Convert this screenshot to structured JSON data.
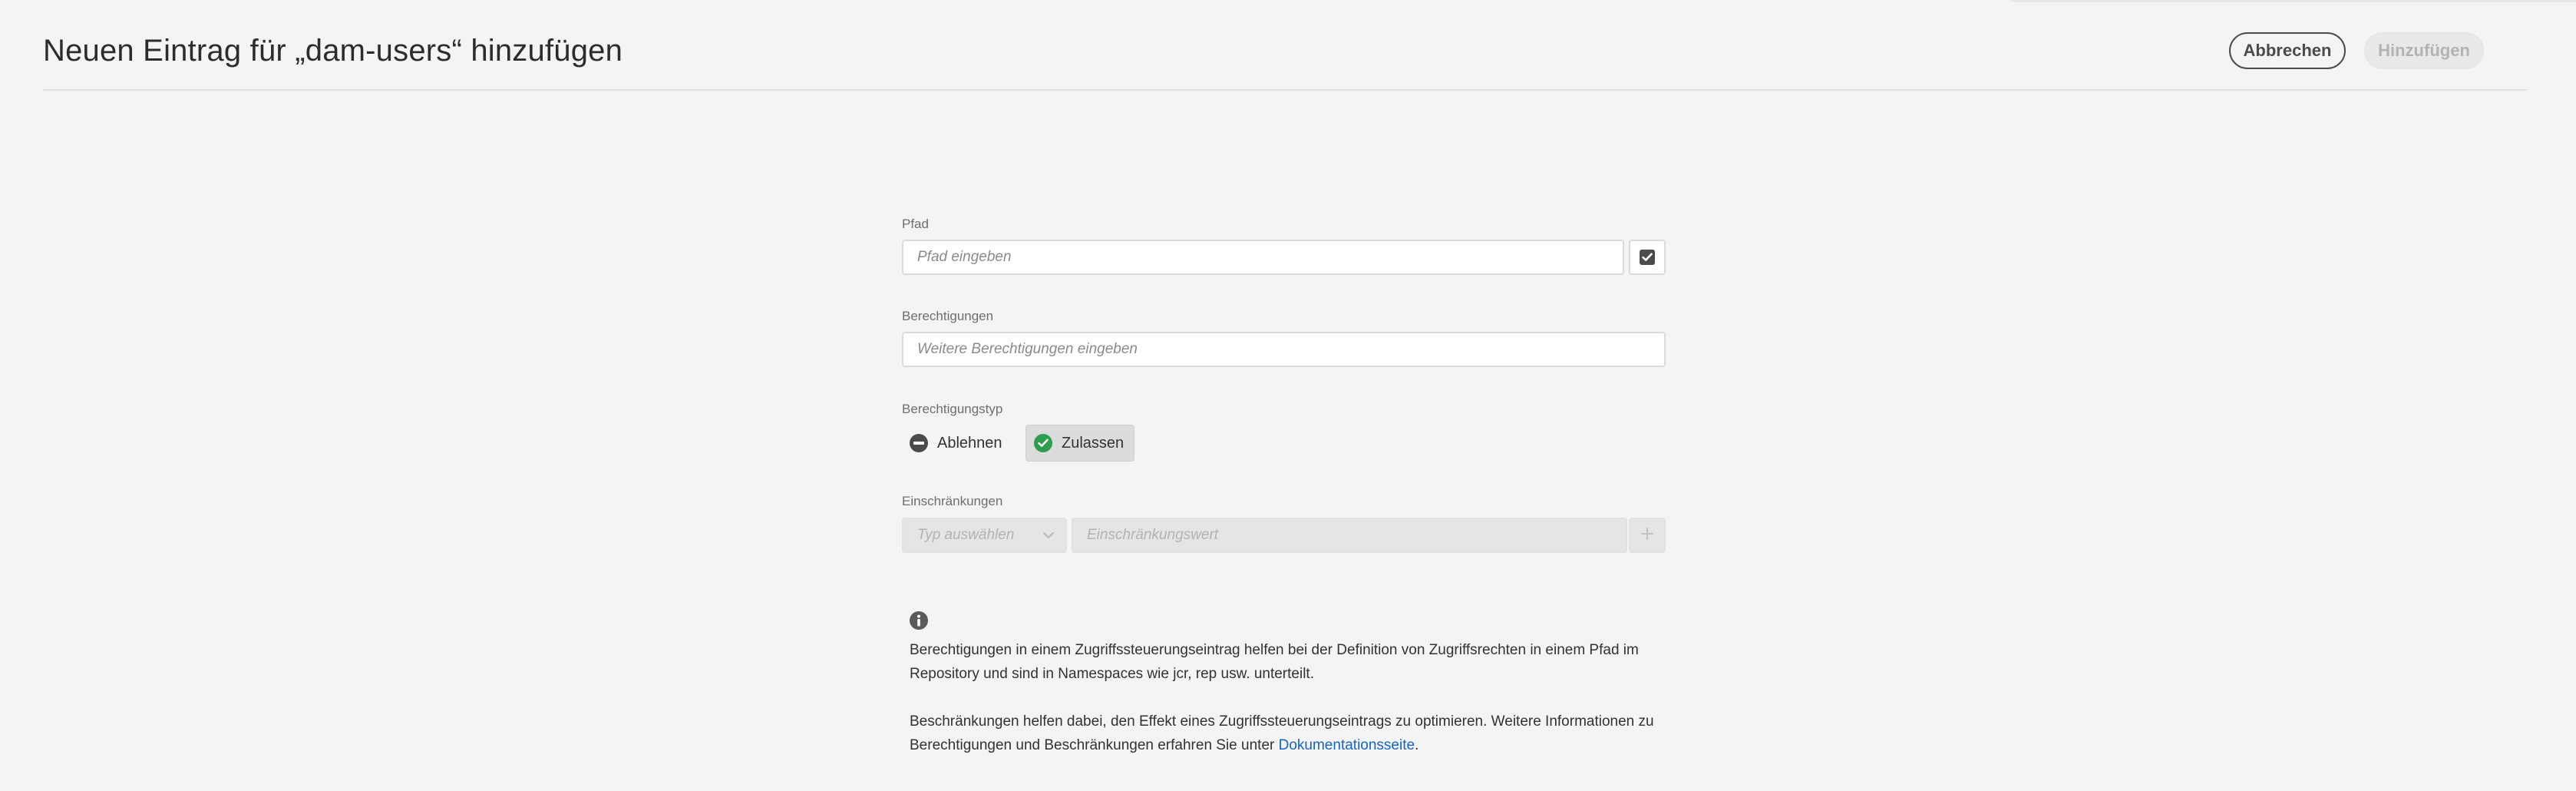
{
  "header": {
    "title": "Neuen Eintrag für „dam-users“ hinzufügen",
    "cancel_label": "Abbrechen",
    "add_label": "Hinzufügen"
  },
  "form": {
    "path": {
      "label": "Pfad",
      "placeholder": "Pfad eingeben"
    },
    "permissions": {
      "label": "Berechtigungen",
      "placeholder": "Weitere Berechtigungen eingeben"
    },
    "permission_type": {
      "label": "Berechtigungstyp",
      "options": [
        {
          "label": "Ablehnen",
          "icon": "minus-circle-icon",
          "selected": false
        },
        {
          "label": "Zulassen",
          "icon": "checkmark-circle-icon",
          "selected": true
        }
      ]
    },
    "restrictions": {
      "label": "Einschränkungen",
      "type_placeholder": "Typ auswählen",
      "value_placeholder": "Einschränkungswert"
    }
  },
  "help": {
    "paragraph1": "Berechtigungen in einem Zugriffssteuerungseintrag helfen bei der Definition von Zugriffsrechten in einem Pfad im Repository und sind in Namespaces wie jcr, rep usw. unterteilt.",
    "paragraph2_prefix": "Beschränkungen helfen dabei, den Effekt eines Zugriffssteuerungseintrags zu optimieren. Weitere Informationen zu Berechtigungen und Beschränkungen erfahren Sie unter ",
    "link_label": "Dokumentationsseite",
    "paragraph2_suffix": "."
  },
  "colors": {
    "accent_link": "#1464c8",
    "allow_green": "#2d9d4e",
    "background": "#f4f4f4"
  }
}
